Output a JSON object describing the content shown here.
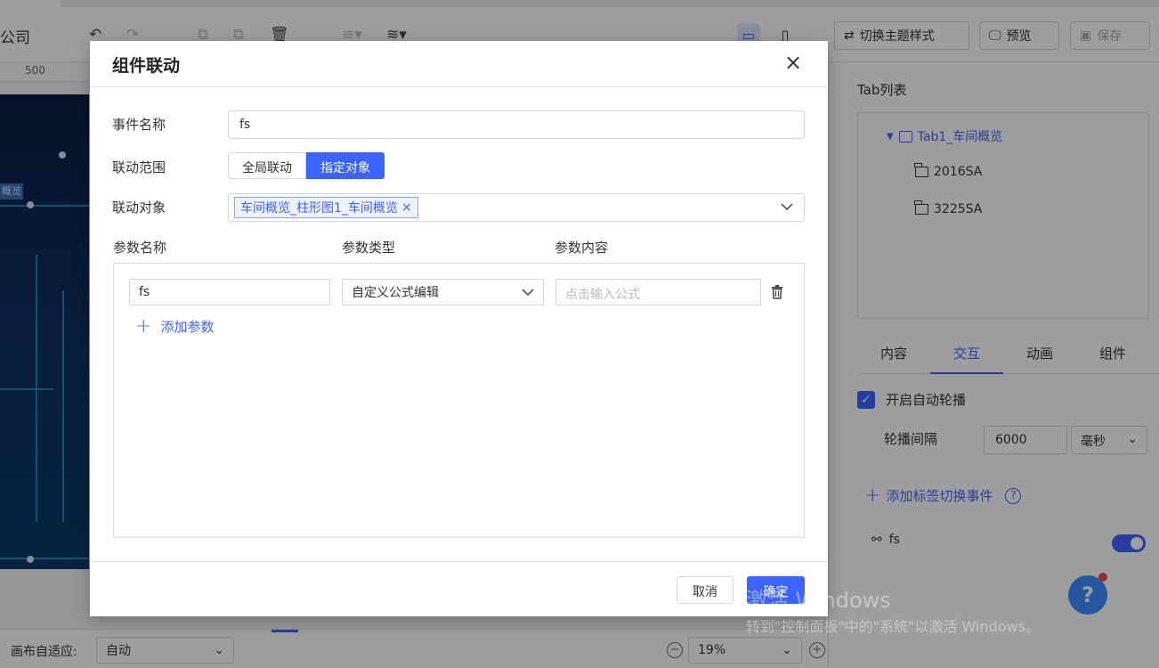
{
  "toolbar": {
    "company_fragment": "公司",
    "theme_button": "切换主题样式",
    "preview_button": "预览",
    "save_button": "保存"
  },
  "ruler": {
    "mark": "500"
  },
  "canvas": {
    "chip_label": "概览"
  },
  "bottom": {
    "fit_label": "画布自适应:",
    "fit_value": "自动",
    "zoom_value": "19%"
  },
  "right_panel": {
    "tab_list_title": "Tab列表",
    "tabs_tree": [
      {
        "label": "Tab1_车间概览",
        "selected": true
      },
      {
        "label": "2016SA"
      },
      {
        "label": "3225SA"
      }
    ],
    "panel_tabs": [
      "内容",
      "交互",
      "动画",
      "组件"
    ],
    "active_tab": "交互",
    "autoplay_label": "开启自动轮播",
    "autoplay_checked": true,
    "interval_label": "轮播间隔",
    "interval_value": "6000",
    "interval_unit": "毫秒",
    "add_event_label": "添加标签切换事件",
    "event_name": "fs",
    "event_enabled": true
  },
  "watermark": {
    "line1": "激活 Windows",
    "line2": "转到\"控制面板\"中的\"系统\"以激活 Windows。"
  },
  "dialog": {
    "title": "组件联动",
    "event_name_label": "事件名称",
    "event_name_value": "fs",
    "scope_label": "联动范围",
    "scope_options": [
      "全局联动",
      "指定对象"
    ],
    "scope_selected": "指定对象",
    "target_label": "联动对象",
    "target_tags": [
      "车间概览_柱形图1_车间概览"
    ],
    "params_header": {
      "name": "参数名称",
      "type": "参数类型",
      "content": "参数内容"
    },
    "params": [
      {
        "name": "fs",
        "type": "自定义公式编辑",
        "content_placeholder": "点击输入公式"
      }
    ],
    "add_param_label": "添加参数",
    "cancel_label": "取消",
    "ok_label": "确定"
  },
  "colors": {
    "primary": "#3d63ff",
    "overlay": "rgba(0,0,0,0.38)"
  }
}
